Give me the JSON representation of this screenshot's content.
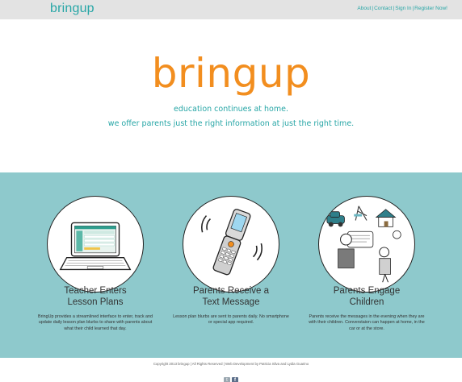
{
  "header": {
    "brand": "bringup",
    "nav": [
      {
        "label": "About"
      },
      {
        "label": "Contact"
      },
      {
        "label": "Sign In"
      },
      {
        "label": "Register Now!"
      }
    ],
    "separator": "|"
  },
  "hero": {
    "title": "bringup",
    "line1": "education continues at home.",
    "line2": "we offer parents just the right information at just the right time."
  },
  "features": [
    {
      "title_line1": "Teacher Enters",
      "title_line2": "Lesson Plans",
      "description": "BringUp provides a streamlined interface to enter, track and update daily lesson plan blurbs to share with parents about what their child learned that day."
    },
    {
      "title_line1": "Parents Receive a",
      "title_line2": "Text Message",
      "description": "Lesson plan blurbs are sent to parents daily. No smartphone or special app required."
    },
    {
      "title_line1": "Parents Engage",
      "title_line2": "Children",
      "description": "Parents receive the messages in the evening when they are with their children. Converstaion can happen at home, in the car or at the store."
    }
  ],
  "footer": {
    "copyright": "Copyright 2013 bringup | All Rights Reserved | Web Development by Patricia Silva and Lydia Guarino",
    "twitter_glyph": "t",
    "facebook_glyph": "f"
  },
  "colors": {
    "brand_teal": "#27a6a6",
    "hero_orange": "#f28e1f",
    "features_bg": "#8ec9cc",
    "topbar_bg": "#e3e3e3"
  },
  "icons": [
    "laptop-illustration",
    "flip-phone-illustration",
    "family-activities-illustration",
    "twitter-icon",
    "facebook-icon"
  ]
}
